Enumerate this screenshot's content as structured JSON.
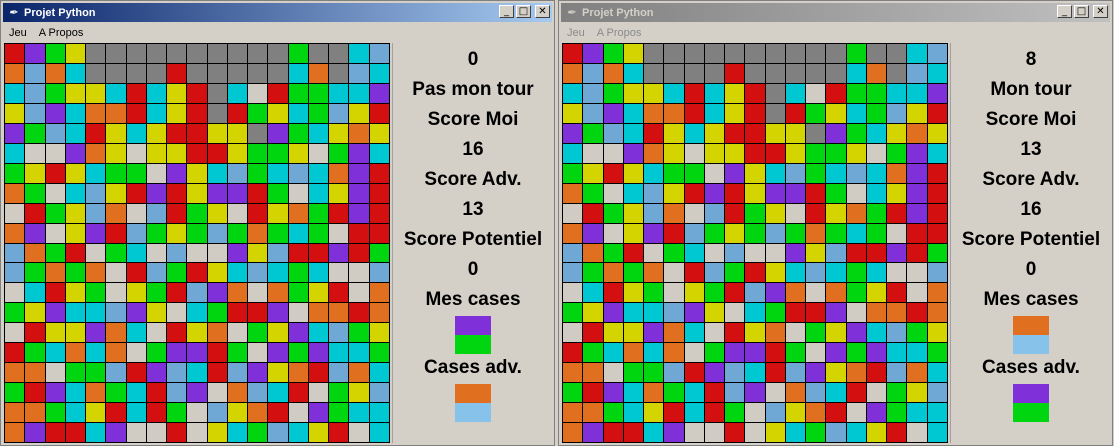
{
  "colors": {
    "R": "#d40f0f",
    "G": "#00d60f",
    "B": "#6fa8d4",
    "LB": "#86c2ea",
    "C": "#00c8d2",
    "Y": "#d4d400",
    "P": "#8030d8",
    "O": "#e07020",
    "L": "#d0ccc4",
    "D": "#808080"
  },
  "left_window": {
    "title": "Projet Python",
    "menu": [
      "Jeu",
      "A Propos"
    ],
    "panel": {
      "turn_counter": "0",
      "turn_status": "Pas mon tour",
      "score_moi_label": "Score Moi",
      "score_moi_value": "16",
      "score_adv_label": "Score Adv.",
      "score_adv_value": "13",
      "score_potentiel_label": "Score Potentiel",
      "score_potentiel_value": "0",
      "mes_cases_label": "Mes cases",
      "mes_cases_colors": [
        "P",
        "G"
      ],
      "cases_adv_label": "Cases adv.",
      "cases_adv_colors": [
        "O",
        "LB"
      ]
    },
    "grid": [
      "RPGYDDDDDDDDDDGDDCB",
      "OBOCDDDDRDDDDDCODBC",
      "CBGYYCRCYRDCLRGGCCP",
      "YBPCOORCYRDRGYCGBYR",
      "PGBCRYCYRRYYDPGCYOY",
      "CLLPOYLYYRRYGGYLGPC",
      "GYRYCGGLPYCBGCBCOPR",
      "OGLCBYRPRYPPRGLCYPR",
      "LRGYBOLBRGYLRYOGRPR",
      "OPLYPRBGYGBGOGCGLRR",
      "BOGRLGCLBLLPYBRRPRG",
      "BGOGOLRBGRYCBCGCLLB",
      "LCRYGLYGRBPOLOGYRLO",
      "GYPCCBPYLCGRRPLOORO",
      "LRYYPOCLRYOLGYPCBGY",
      "RGCOCOLGPPRGLPGPCCG",
      "OOLGGBRPBCRBPYORBOC",
      "GRPCOGCRBPLOBCRLGYB",
      "OOGCYRCRGLBYORLPGCC",
      "OPRRCPLLRLYCGBCYRLC"
    ]
  },
  "right_window": {
    "title": "Projet Python",
    "menu": [
      "Jeu",
      "A Propos"
    ],
    "panel": {
      "turn_counter": "8",
      "turn_status": "Mon tour",
      "score_moi_label": "Score Moi",
      "score_moi_value": "13",
      "score_adv_label": "Score Adv.",
      "score_adv_value": "16",
      "score_potentiel_label": "Score Potentiel",
      "score_potentiel_value": "0",
      "mes_cases_label": "Mes cases",
      "mes_cases_colors": [
        "O",
        "LB"
      ],
      "cases_adv_label": "Cases adv.",
      "cases_adv_colors": [
        "P",
        "G"
      ]
    },
    "grid": [
      "RPGYDDDDDDDDDDGDDCB",
      "OBOCDDDDRDDDDDCODBC",
      "CBGYYCRCYRDCLRGGCCP",
      "YBPCOORCYRDRGYCGBYR",
      "PGBCRYCYRRYYDPGCYOY",
      "CLLPOYLYYRRYGGYLGPC",
      "GYRYCGGLPYCBGCBCOPR",
      "OGLCBYRPRYPPRGLCYPR",
      "LRGYBOLBRGYLRYOGRPR",
      "OPLYPRBGYGBGOGCGLRR",
      "BOGRLGCLBLLPYBRRPRG",
      "BGOGOLRBGRYCBCGCLLB",
      "LCRYGLYGRBPOLOGYRLO",
      "GYPCCBPYLCGRRPLOORO",
      "LRYYPOCLRYOLGYPCBGY",
      "RGCOCOLGPPRGLPGPCCG",
      "OOLGGBRPBCRBPYORBOC",
      "GRPCOGCRBPLOBCRLGYB",
      "OOGCYRCRGLBYORLPGCC",
      "OPRRCPLLRLYCGBCYRLC"
    ]
  }
}
